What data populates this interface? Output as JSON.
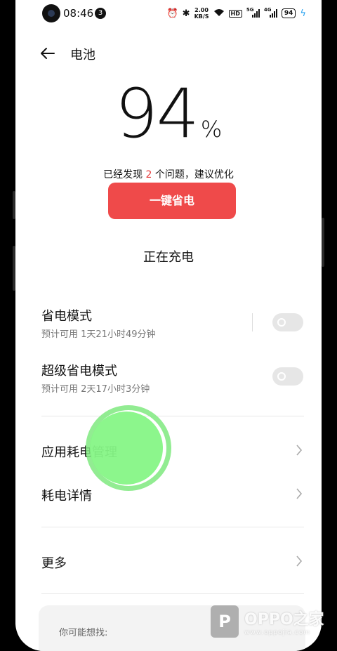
{
  "status_bar": {
    "time": "08:46",
    "notification_count": "3",
    "net_speed_value": "2.00",
    "net_speed_unit": "KB/S",
    "hd_label": "HD",
    "sim1_label": "5G",
    "sim2_label": "4G",
    "battery_level": "94"
  },
  "header": {
    "title": "电池"
  },
  "battery": {
    "percent": "94",
    "percent_sign": "%"
  },
  "issues": {
    "prefix": "已经发现 ",
    "count": "2",
    "suffix": " 个问题，建议优化"
  },
  "optimize_button": {
    "label": "一键省电"
  },
  "charging_status": "正在充电",
  "power_saving": {
    "title": "省电模式",
    "estimate": "预计可用 1天21小时49分钟",
    "enabled": false
  },
  "super_power_saving": {
    "title": "超级省电模式",
    "estimate": "预计可用 2天17小时3分钟",
    "enabled": false
  },
  "menu": {
    "app_usage": "应用耗电管理",
    "details": "耗电详情",
    "more": "更多"
  },
  "suggestions": {
    "label": "你可能想找:"
  },
  "watermark": {
    "logo": "P",
    "brand": "OPPO之家",
    "url": "www.oppojia.com"
  },
  "colors": {
    "accent_red": "#ef4a4a",
    "tap_indicator": "#86f686",
    "charging_bolt": "#2aa3f0"
  }
}
